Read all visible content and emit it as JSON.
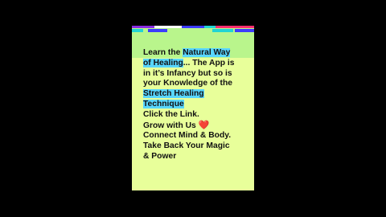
{
  "post": {
    "lines": [
      {
        "pre": "Learn the ",
        "highlight": "Natural Way"
      },
      {
        "highlight": "of Healing",
        "post": "... The App is"
      },
      {
        "text": "in it’s Infancy but so is"
      },
      {
        "text": "your Knowledge of the"
      },
      {
        "highlight": "Stretch Healing"
      },
      {
        "highlight": "Technique"
      },
      {
        "text": "Click the Link."
      },
      {
        "text": "Grow with Us ",
        "emoji": "❤️"
      },
      {
        "text": "Connect Mind & Body."
      },
      {
        "text": "Take Back Your Magic"
      },
      {
        "text": "& Power"
      }
    ]
  },
  "colors": {
    "background": "#000000",
    "card": "#e8ff9a",
    "highlight": "#58d6ff",
    "heart": "#e01b1b"
  },
  "icons": {
    "heart": "heart-emoji-icon"
  }
}
